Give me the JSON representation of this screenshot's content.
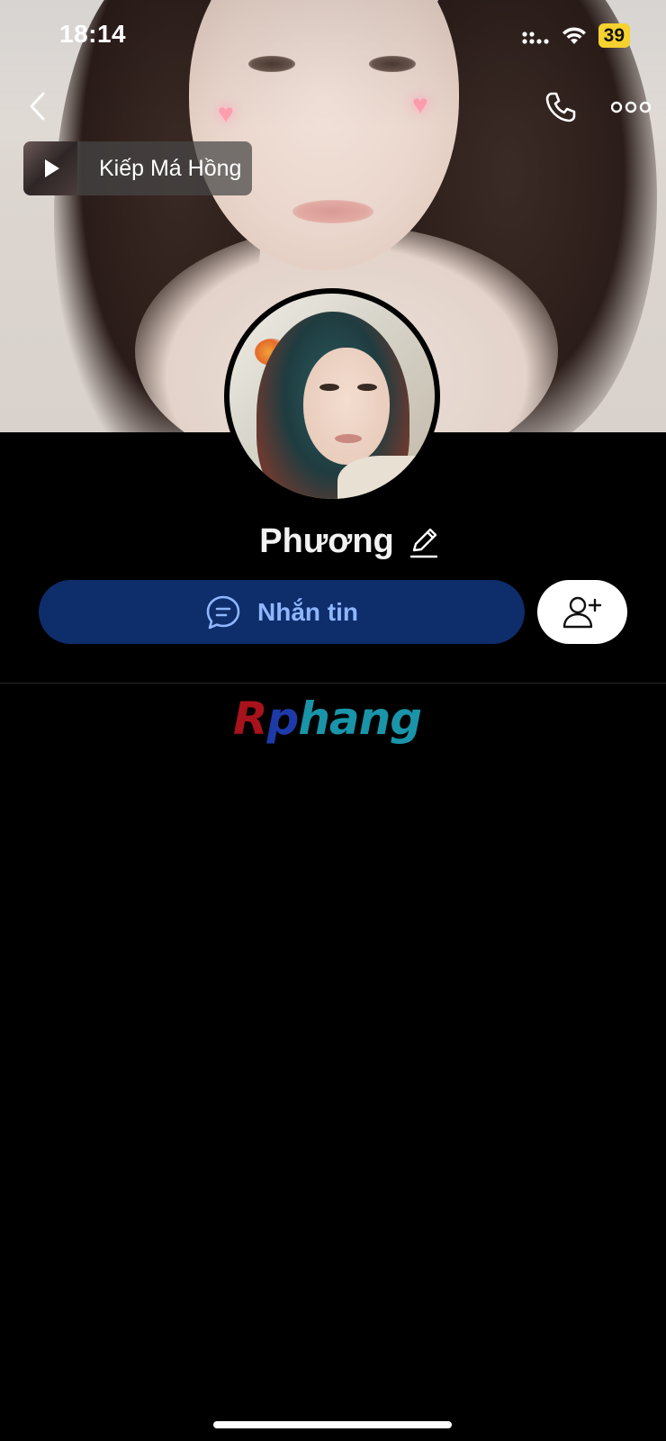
{
  "status_bar": {
    "time": "18:14",
    "battery_level": "39",
    "battery_color": "#f5d230"
  },
  "nav": {
    "back_icon": "chevron-left-icon",
    "call_icon": "phone-icon",
    "more_icon": "more-horizontal-icon"
  },
  "music": {
    "title": "Kiếp Má Hồng",
    "thumb_icon": "play-icon"
  },
  "profile": {
    "name": "Phương",
    "edit_icon": "pencil-icon"
  },
  "actions": {
    "message_label": "Nhắn tin",
    "message_icon": "chat-bubble-icon",
    "message_bg": "#0e2d6b",
    "message_text_color": "#8fb6ff",
    "add_friend_icon": "add-user-icon"
  },
  "watermark": {
    "part1": "R",
    "part2": "p",
    "part3": "hang"
  }
}
